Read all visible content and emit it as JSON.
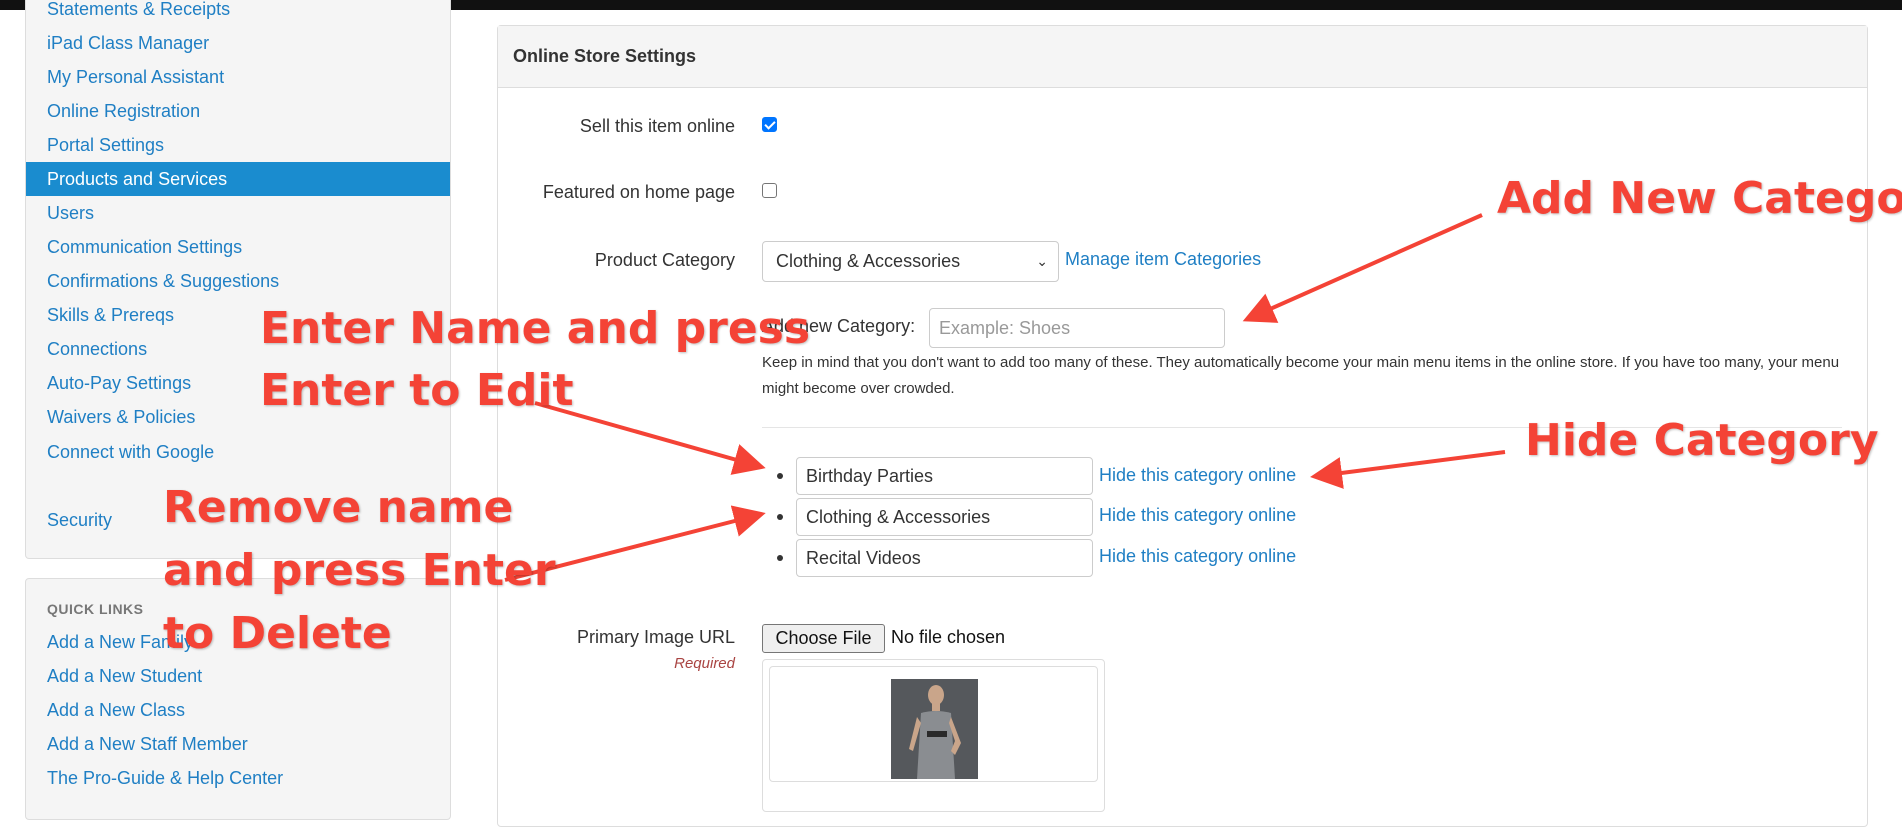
{
  "sidebar": {
    "items": [
      {
        "label": "Statements & Receipts"
      },
      {
        "label": "iPad Class Manager"
      },
      {
        "label": "My Personal Assistant"
      },
      {
        "label": "Online Registration"
      },
      {
        "label": "Portal Settings"
      },
      {
        "label": "Products and Services"
      },
      {
        "label": "Users"
      },
      {
        "label": "Communication Settings"
      },
      {
        "label": "Confirmations & Suggestions"
      },
      {
        "label": "Skills & Prereqs"
      },
      {
        "label": "Connections"
      },
      {
        "label": "Auto-Pay Settings"
      },
      {
        "label": "Waivers & Policies"
      },
      {
        "label": "Connect with Google"
      },
      {
        "label": "Security"
      }
    ],
    "active_item": "Products and Services"
  },
  "quick_links": {
    "title": "QUICK LINKS",
    "items": [
      {
        "label": "Add a New Family"
      },
      {
        "label": "Add a New Student"
      },
      {
        "label": "Add a New Class"
      },
      {
        "label": "Add a New Staff Member"
      },
      {
        "label": "The Pro-Guide & Help Center"
      }
    ]
  },
  "panel": {
    "title": "Online Store Settings",
    "sell_online": {
      "label": "Sell this item online",
      "checked": true
    },
    "featured": {
      "label": "Featured on home page",
      "checked": false
    },
    "product_category": {
      "label": "Product Category",
      "selected": "Clothing & Accessories",
      "manage_link": "Manage item Categories"
    },
    "add_category": {
      "label": "Add new Category:",
      "placeholder": "Example: Shoes"
    },
    "help_text": "Keep in mind that you don't want to add too many of these. They automatically become your main menu items in the online store. If you have too many, your menu might become over crowded.",
    "categories": [
      {
        "name": "Birthday Parties",
        "hide_link": "Hide this category online"
      },
      {
        "name": "Clothing & Accessories",
        "hide_link": "Hide this category online"
      },
      {
        "name": "Recital Videos",
        "hide_link": "Hide this category online"
      }
    ],
    "primary_image": {
      "label": "Primary Image URL",
      "required": "Required",
      "button": "Choose File",
      "status": "No file chosen"
    }
  },
  "annotations": {
    "add_new_category": "Add New Category",
    "enter_name_line1": "Enter Name and press",
    "enter_name_line2": "Enter to Edit",
    "hide_category": "Hide Category",
    "remove_line1": "Remove name",
    "remove_line2": "and press Enter",
    "remove_line3": "to Delete",
    "color": "#f44336"
  },
  "colors": {
    "link": "#1f7fc4",
    "active_bg": "#1a8ccf",
    "checkbox": "#0075ff"
  }
}
